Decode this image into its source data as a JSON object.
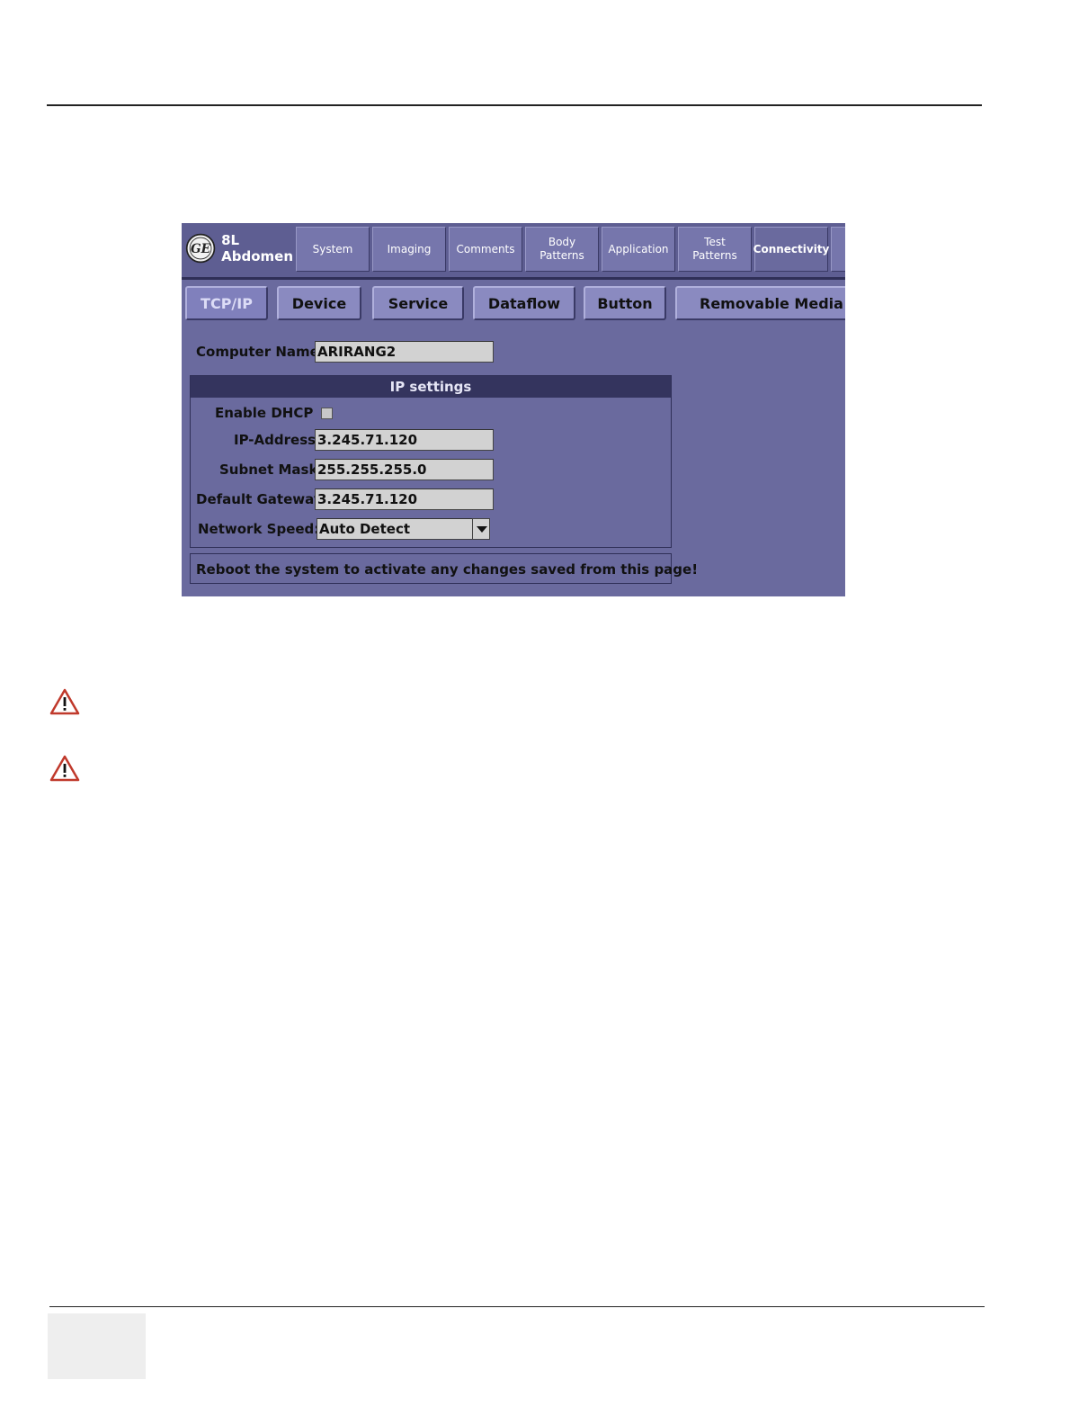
{
  "header": {
    "probe": "8L",
    "preset": "Abdomen"
  },
  "tabs": [
    {
      "label": "System"
    },
    {
      "label": "Imaging"
    },
    {
      "label": "Comments"
    },
    {
      "label": "Body\nPatterns"
    },
    {
      "label": "Application"
    },
    {
      "label": "Test\nPatterns"
    },
    {
      "label": "Connectivity",
      "active": true
    }
  ],
  "subtabs": [
    {
      "label": "TCP/IP",
      "active": true
    },
    {
      "label": "Device"
    },
    {
      "label": "Service"
    },
    {
      "label": "Dataflow"
    },
    {
      "label": "Button"
    },
    {
      "label": "Removable Media"
    }
  ],
  "form": {
    "computer_name_label": "Computer Name",
    "computer_name_value": "ARIRANG2",
    "ip_settings_title": "IP settings",
    "enable_dhcp_label": "Enable DHCP",
    "enable_dhcp_checked": false,
    "ip_address_label": "IP-Address",
    "ip_address_value": "3.245.71.120",
    "subnet_mask_label": "Subnet Mask",
    "subnet_mask_value": "255.255.255.0",
    "default_gateway_label": "Default Gateway",
    "default_gateway_value": "3.245.71.120",
    "network_speed_label": "Network Speed:",
    "network_speed_value": "Auto Detect",
    "reboot_note": "Reboot the system to activate any changes saved from this page!"
  },
  "icons": {
    "logo": "ge-logo-icon",
    "warning": "warning-triangle-icon",
    "dropdown": "chevron-down-icon"
  },
  "colors": {
    "screen_bg": "#6a6a9e",
    "header_bar": "#34345e",
    "warning_red": "#c0392b"
  }
}
